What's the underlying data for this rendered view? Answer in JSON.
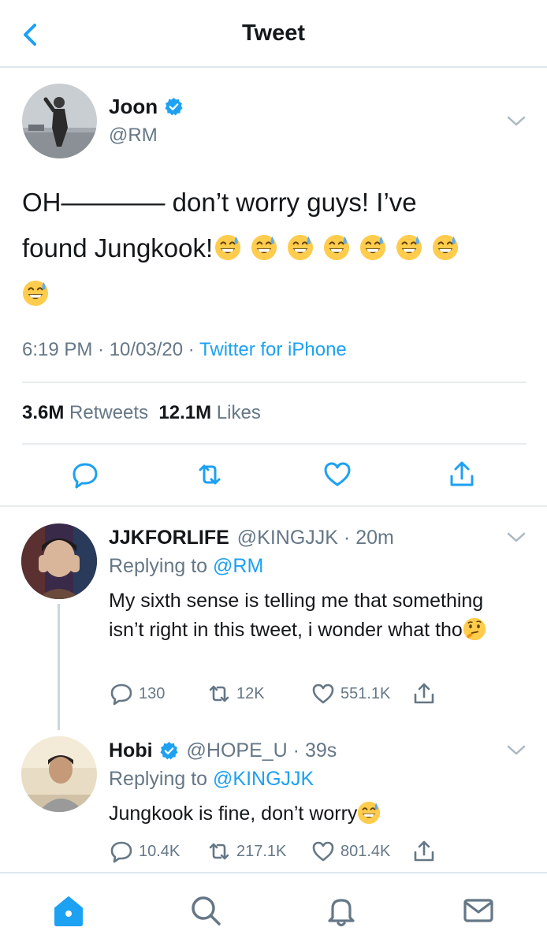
{
  "header": {
    "title": "Tweet"
  },
  "main_tweet": {
    "display_name": "Joon",
    "handle": "@RM",
    "text_line1": "OH———— don’t worry guys! I’ve",
    "text_line2": "found Jungkook!",
    "emoji": "grinning-face-with-sweat",
    "emoji_count": 8,
    "time": "6:19 PM · 10/03/20 · ",
    "source": "Twitter for iPhone",
    "retweets_count": "3.6M",
    "retweets_label": "Retweets",
    "likes_count": "12.1M",
    "likes_label": "Likes"
  },
  "replies": [
    {
      "display_name": "JJKFORLIFE",
      "handle_time": "@KINGJJK · 20m",
      "replying_prefix": "Replying to ",
      "replying_to": "@RM",
      "text": "My sixth sense is telling me that something isn’t right in this tweet, i wonder what tho",
      "emoji": "thinking-face",
      "reply_count": "130",
      "retweet_count": "12K",
      "like_count": "551.1K"
    },
    {
      "display_name": "Hobi",
      "handle_time": "@HOPE_U · 39s",
      "replying_prefix": "Replying to ",
      "replying_to": "@KINGJJK",
      "text": "Jungkook is fine, don’t worry",
      "emoji": "grinning-face-with-sweat",
      "reply_count": "10.4K",
      "retweet_count": "217.1K",
      "like_count": "801.4K"
    }
  ],
  "nav": [
    "home",
    "search",
    "notifications",
    "messages"
  ],
  "colors": {
    "accent": "#1da1f2",
    "secondary_text": "#657786",
    "primary_text": "#14171a",
    "border": "#e6ecf0"
  }
}
